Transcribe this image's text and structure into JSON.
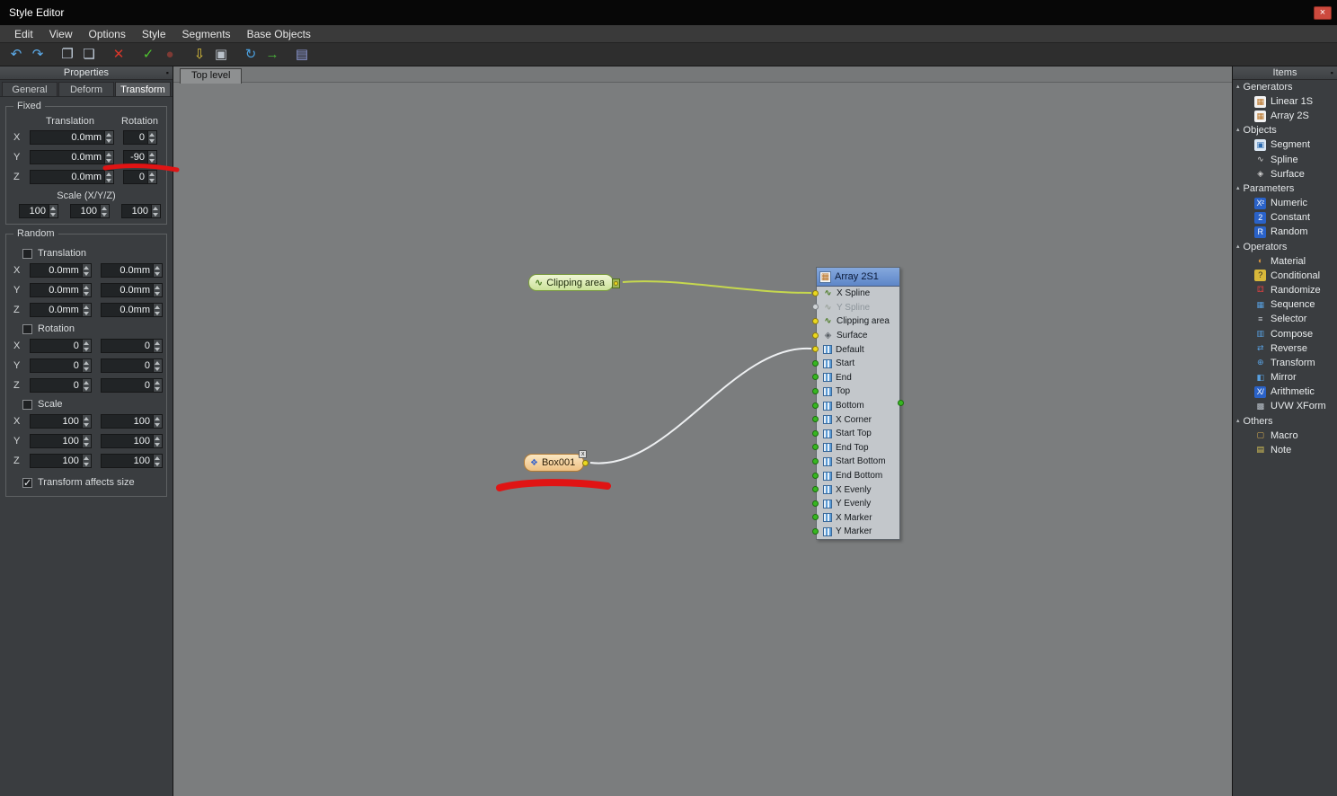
{
  "window": {
    "title": "Style Editor",
    "close_glyph": "×"
  },
  "menu": {
    "items": [
      "Edit",
      "View",
      "Options",
      "Style",
      "Segments",
      "Base Objects"
    ]
  },
  "toolbar": {
    "icons": [
      {
        "name": "undo-icon",
        "glyph": "↶",
        "color": "#5caae8"
      },
      {
        "name": "redo-icon",
        "glyph": "↷",
        "color": "#5caae8"
      },
      {
        "name": "copy-icon",
        "glyph": "❐",
        "color": "#c2cedb"
      },
      {
        "name": "paste-icon",
        "glyph": "❏",
        "color": "#c2cedb"
      },
      {
        "name": "delete-icon",
        "glyph": "✕",
        "color": "#d8362a"
      },
      {
        "name": "check-update-icon",
        "glyph": "✓",
        "color": "#4fc32f"
      },
      {
        "name": "auto-update-icon",
        "glyph": "●",
        "color": "#7e3a34"
      },
      {
        "name": "filter-icon",
        "glyph": "⇩",
        "color": "#dfc23a"
      },
      {
        "name": "package-icon",
        "glyph": "▣",
        "color": "#b9c1c9"
      },
      {
        "name": "refresh-icon",
        "glyph": "↻",
        "color": "#4b9fdd"
      },
      {
        "name": "export-icon",
        "glyph": "→",
        "color": "#49b33a"
      },
      {
        "name": "library-icon",
        "glyph": "▤",
        "color": "#8f9bd8"
      }
    ]
  },
  "properties": {
    "header": "Properties",
    "tabs": [
      {
        "label": "General"
      },
      {
        "label": "Deform"
      },
      {
        "label": "Transform"
      }
    ],
    "fixed": {
      "title": "Fixed",
      "headers": {
        "translation": "Translation",
        "rotation": "Rotation"
      },
      "rows": [
        {
          "axis": "X",
          "translation": "0.0mm",
          "rotation": "0"
        },
        {
          "axis": "Y",
          "translation": "0.0mm",
          "rotation": "-90"
        },
        {
          "axis": "Z",
          "translation": "0.0mm",
          "rotation": "0"
        }
      ],
      "scale_label": "Scale (X/Y/Z)",
      "scale_values": [
        "100",
        "100",
        "100"
      ]
    },
    "random": {
      "title": "Random",
      "sections": [
        {
          "label": "Translation",
          "checked": false,
          "rows": [
            {
              "axis": "X",
              "v1": "0.0mm",
              "v2": "0.0mm"
            },
            {
              "axis": "Y",
              "v1": "0.0mm",
              "v2": "0.0mm"
            },
            {
              "axis": "Z",
              "v1": "0.0mm",
              "v2": "0.0mm"
            }
          ]
        },
        {
          "label": "Rotation",
          "checked": false,
          "rows": [
            {
              "axis": "X",
              "v1": "0",
              "v2": "0"
            },
            {
              "axis": "Y",
              "v1": "0",
              "v2": "0"
            },
            {
              "axis": "Z",
              "v1": "0",
              "v2": "0"
            }
          ]
        },
        {
          "label": "Scale",
          "checked": false,
          "rows": [
            {
              "axis": "X",
              "v1": "100",
              "v2": "100"
            },
            {
              "axis": "Y",
              "v1": "100",
              "v2": "100"
            },
            {
              "axis": "Z",
              "v1": "100",
              "v2": "100"
            }
          ]
        }
      ],
      "footer_checkbox": {
        "label": "Transform affects size",
        "checked": true
      }
    }
  },
  "canvas": {
    "tab": "Top level",
    "nodes": {
      "clipping": {
        "label": "Clipping area",
        "icon_glyph": "∿"
      },
      "box": {
        "label": "Box001",
        "icon_glyph": "❖",
        "badge": "x"
      },
      "array": {
        "title": "Array 2S1",
        "icon_glyph": "▦",
        "slots": [
          {
            "label": "X Spline",
            "dot": "dot-yellow",
            "icon": "icon-spline",
            "state": ""
          },
          {
            "label": "Y Spline",
            "dot": "dot-gray",
            "icon": "icon-spline",
            "state": "disabled"
          },
          {
            "label": "Clipping area",
            "dot": "dot-yellow",
            "icon": "icon-spline",
            "state": ""
          },
          {
            "label": "Surface",
            "dot": "dot-yellow",
            "icon": "icon-surface",
            "state": ""
          },
          {
            "label": "Default",
            "dot": "dot-yellow",
            "icon": "icon-segment",
            "state": ""
          },
          {
            "label": "Start",
            "dot": "dot-green",
            "icon": "icon-segment",
            "state": ""
          },
          {
            "label": "End",
            "dot": "dot-green",
            "icon": "icon-segment",
            "state": ""
          },
          {
            "label": "Top",
            "dot": "dot-green",
            "icon": "icon-segment",
            "state": ""
          },
          {
            "label": "Bottom",
            "dot": "dot-green",
            "icon": "icon-segment",
            "state": ""
          },
          {
            "label": "X Corner",
            "dot": "dot-green",
            "icon": "icon-segment",
            "state": ""
          },
          {
            "label": "Start Top",
            "dot": "dot-green",
            "icon": "icon-segment",
            "state": ""
          },
          {
            "label": "End Top",
            "dot": "dot-green",
            "icon": "icon-segment",
            "state": ""
          },
          {
            "label": "Start Bottom",
            "dot": "dot-green",
            "icon": "icon-segment",
            "state": ""
          },
          {
            "label": "End Bottom",
            "dot": "dot-green",
            "icon": "icon-segment",
            "state": ""
          },
          {
            "label": "X Evenly",
            "dot": "dot-green",
            "icon": "icon-segment",
            "state": ""
          },
          {
            "label": "Y Evenly",
            "dot": "dot-green",
            "icon": "icon-segment",
            "state": ""
          },
          {
            "label": "X Marker",
            "dot": "dot-green",
            "icon": "icon-segment",
            "state": ""
          },
          {
            "label": "Y Marker",
            "dot": "dot-green",
            "icon": "icon-segment",
            "state": ""
          }
        ]
      }
    },
    "wires": [
      {
        "name": "clipping-to-xspline",
        "color": "#c6d84e"
      },
      {
        "name": "box001-to-default",
        "color": "#eef0f2"
      }
    ]
  },
  "items_panel": {
    "header": "Items",
    "groups": [
      {
        "label": "Generators",
        "items": [
          {
            "label": "Linear 1S",
            "icon": {
              "glyph": "▦",
              "fg": "#b87020",
              "bg": "#f2f2f2"
            }
          },
          {
            "label": "Array 2S",
            "icon": {
              "glyph": "▦",
              "fg": "#b87020",
              "bg": "#f2f2f2"
            }
          }
        ]
      },
      {
        "label": "Objects",
        "items": [
          {
            "label": "Segment",
            "icon": {
              "glyph": "▣",
              "fg": "#2a6ab0",
              "bg": "#dce8f4"
            }
          },
          {
            "label": "Spline",
            "icon": {
              "glyph": "∿",
              "fg": "#d8d8d8"
            }
          },
          {
            "label": "Surface",
            "icon": {
              "glyph": "◈",
              "fg": "#d0d0d0"
            }
          }
        ]
      },
      {
        "label": "Parameters",
        "items": [
          {
            "label": "Numeric",
            "icon": {
              "glyph": "X²",
              "fg": "#ffffff",
              "bg": "#2a62c8"
            }
          },
          {
            "label": "Constant",
            "icon": {
              "glyph": "2",
              "fg": "#ffffff",
              "bg": "#2a62c8"
            }
          },
          {
            "label": "Random",
            "icon": {
              "glyph": "R",
              "fg": "#ffffff",
              "bg": "#2a62c8"
            }
          }
        ]
      },
      {
        "label": "Operators",
        "items": [
          {
            "label": "Material",
            "icon": {
              "glyph": "◐",
              "fg": "#e09a40"
            }
          },
          {
            "label": "Conditional",
            "icon": {
              "glyph": "?",
              "fg": "#222222",
              "bg": "#d8b83a"
            }
          },
          {
            "label": "Randomize",
            "icon": {
              "glyph": "⚃",
              "fg": "#d84040"
            }
          },
          {
            "label": "Sequence",
            "icon": {
              "glyph": "▦",
              "fg": "#58a0e0"
            }
          },
          {
            "label": "Selector",
            "icon": {
              "glyph": "≡",
              "fg": "#c6ccd2"
            }
          },
          {
            "label": "Compose",
            "icon": {
              "glyph": "▥",
              "fg": "#58a0e0"
            }
          },
          {
            "label": "Reverse",
            "icon": {
              "glyph": "⇄",
              "fg": "#58a0e0"
            }
          },
          {
            "label": "Transform",
            "icon": {
              "glyph": "⊕",
              "fg": "#58a0e0"
            }
          },
          {
            "label": "Mirror",
            "icon": {
              "glyph": "◧",
              "fg": "#58a0e0"
            }
          },
          {
            "label": "Arithmetic",
            "icon": {
              "glyph": "X/",
              "fg": "#ffffff",
              "bg": "#2a62c8"
            }
          },
          {
            "label": "UVW XForm",
            "icon": {
              "glyph": "▩",
              "fg": "#bcc4cc"
            }
          }
        ]
      },
      {
        "label": "Others",
        "items": [
          {
            "label": "Macro",
            "icon": {
              "glyph": "▢",
              "fg": "#d0a850"
            }
          },
          {
            "label": "Note",
            "icon": {
              "glyph": "▤",
              "fg": "#e0cc58"
            }
          }
        ]
      }
    ]
  },
  "colors": {
    "annotation": "#e01414",
    "wire_spline": "#c6d84e",
    "wire_segment": "#eef0f2",
    "slot_yellow": "#ead81f",
    "slot_green": "#37b621",
    "selection_header": "#6b93d4"
  }
}
